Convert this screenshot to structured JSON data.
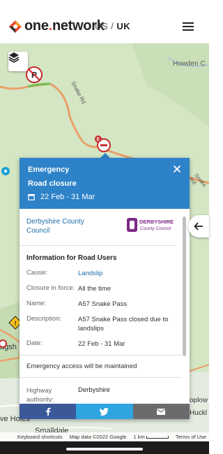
{
  "header": {
    "logo_text_main": "one",
    "logo_text_dot": ".",
    "logo_text_end": "network",
    "region_prefix": "US /",
    "region_current": "UK"
  },
  "map": {
    "labels": {
      "howden": "Howden C",
      "snake_rd": "Snake Rd",
      "snake_rd_2": "Snake Rd",
      "bagsh": "agsh",
      "holes": "ve Holes",
      "smalldale": "Smalldale",
      "oplow": "oplow",
      "huckl": "Huckl"
    },
    "attribution": {
      "shortcuts": "Keyboard shortcuts",
      "map_data": "Map data ©2022 Google",
      "scale": "1 km",
      "terms": "Terms of Use"
    }
  },
  "popup": {
    "category": "Emergency",
    "type": "Road closure",
    "dates": "22 Feb - 31 Mar",
    "council_link": "Derbyshire County Council",
    "council_logo_line1": "DERBYSHIRE",
    "council_logo_line2": "County Council",
    "section_title": "Information for Road Users",
    "info": {
      "cause_label": "Cause:",
      "cause_value": "Landslip",
      "closure_label": "Closure in force:",
      "closure_value": "All the time",
      "name_label": "Name:",
      "name_value": "A57 Snake Pass",
      "description_label": "Description:",
      "description_value": "A57 Snake Pass closed due to landslips",
      "date_label": "Date:",
      "date_value": "22 Feb - 31 Mar"
    },
    "access_note": "Emergency access will be maintained",
    "authority_label": "Highway authority:",
    "authority_value": "Derbyshire"
  },
  "colors": {
    "brand_red": "#e8452f",
    "popup_header": "#2d82c8",
    "link": "#1b6ca8",
    "facebook": "#3b5998",
    "twitter": "#2fa5e0",
    "mail": "#6b6b6b"
  }
}
